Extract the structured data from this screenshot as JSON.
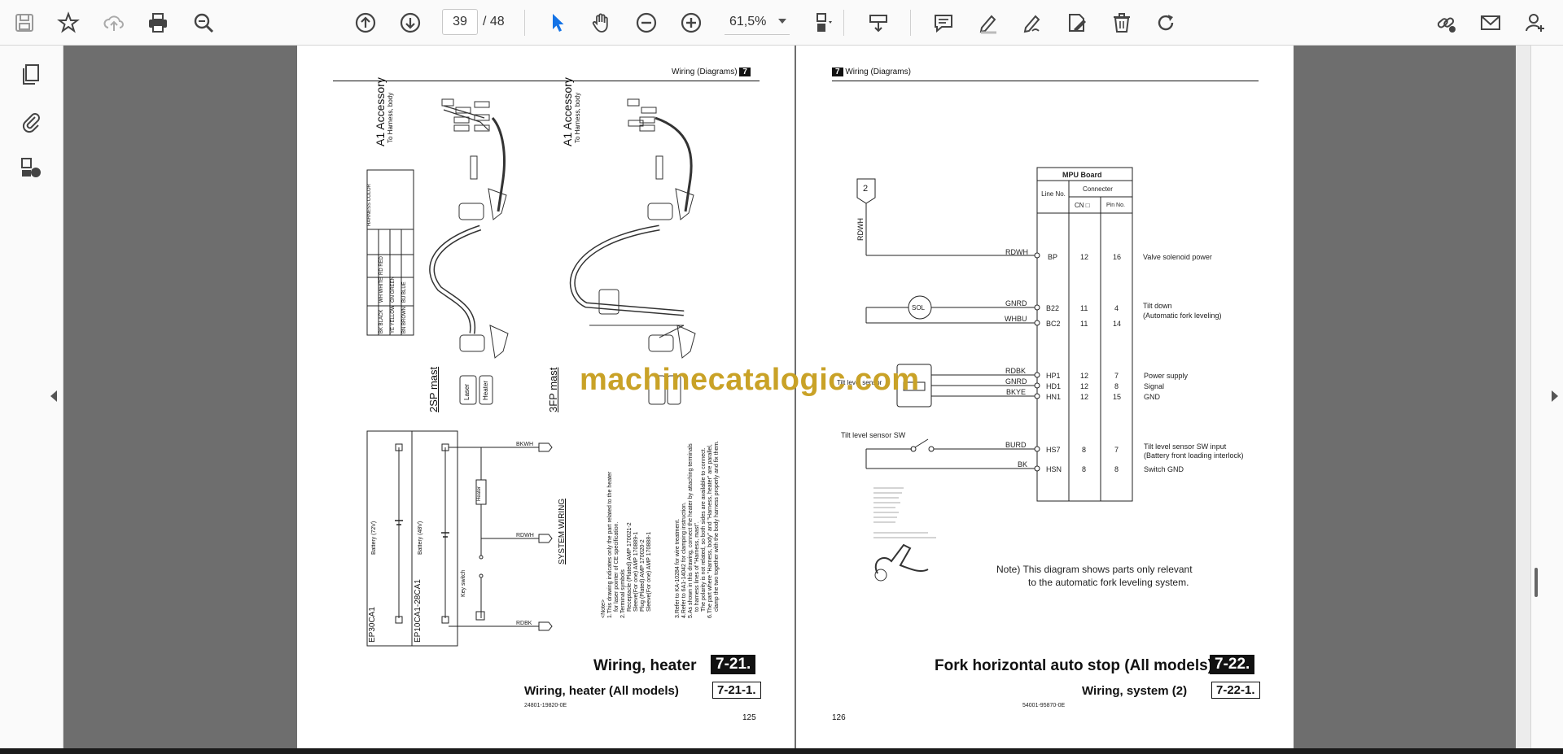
{
  "toolbar": {
    "current_page": "39",
    "total_pages": "/ 48",
    "zoom": "61,5%"
  },
  "page_left": {
    "header": "Wiring (Diagrams)",
    "chapter": "7",
    "accessory_label_1": "A1 Accessory",
    "accessory_label_2": "A1 Accessory",
    "to_harness_1": "To Harness, body",
    "to_harness_2": "To Harness, body",
    "mast_1": "2SP mast",
    "mast_2": "3FP mast",
    "harness_color_title": "HARNESS COLOR",
    "harness_colors": [
      "BK BLACK",
      "YE YELLOW",
      "BN BROWN",
      "WH WHITE",
      "GN GREEN",
      "BU BLUE",
      "RD RED"
    ],
    "laser": "Laser",
    "heater": "Heater",
    "battery_72": "Battery (72V)",
    "battery_48": "Battery (48V)",
    "model_1": "EP30CA1",
    "model_2": "EP10CA1-28CA1",
    "key_switch": "Key switch",
    "heater_box": "Heater",
    "system_wiring": "SYSTEM WIRING",
    "wire_bkwh": "BKWH",
    "wire_rdwh": "RDWH",
    "wire_rdbk": "RDBK",
    "notes": [
      "<Note>",
      "1.This drawing indicates only the part related to the heater",
      "for laser pointer of CE specification.",
      "2.Terminal symbols",
      "Receptacle (Plated)  AMP 170021-2",
      "Sleeve(For one)  AMP 170889-1",
      "Plug (Plated)  AMP 170020-2",
      "Sleeve(For one)  AMP 170888-1",
      "3.Refer to KA-10284 for wire treatment.",
      "4.Refer to 6A1-14042 for clamping instruction.",
      "5.As shown in this drawing, connect the heater by attaching terminals",
      "to harness lines of \"Harness, mast\".",
      "The polarity is not related, so both sides are available to connect.",
      "6.The part where \"Harness, body\" and \"Harness, heater\" are parallel,",
      "clamp the two together with the body harness properly and fix them."
    ],
    "title": "Wiring, heater",
    "number": "7-21.",
    "subtitle": "Wiring, heater (All models)",
    "subnumber": "7-21-1.",
    "docno": "24801-19820-0E",
    "page_no": "125"
  },
  "page_right": {
    "header": "Wiring (Diagrams)",
    "chapter": "7",
    "mpu_board": "MPU Board",
    "line_no": "Line No.",
    "connector": "Connecter",
    "cn": "CN □",
    "pin_no": "Pin No.",
    "ref_2": "2",
    "wire_rdwh": "RDWH",
    "rows": [
      {
        "wire": "RDWH",
        "line": "BP",
        "cn": "12",
        "pin": "16",
        "desc": "Valve solenoid power"
      },
      {
        "wire": "GNRD",
        "line": "B22",
        "cn": "11",
        "pin": "4",
        "desc": "Tilt down"
      },
      {
        "wire": "WHBU",
        "line": "BC2",
        "cn": "11",
        "pin": "14",
        "desc": "(Automatic fork leveling)"
      },
      {
        "wire": "RDBK",
        "line": "HP1",
        "cn": "12",
        "pin": "7",
        "desc": "Power supply"
      },
      {
        "wire": "GNRD",
        "line": "HD1",
        "cn": "12",
        "pin": "8",
        "desc": "Signal"
      },
      {
        "wire": "BKYE",
        "line": "HN1",
        "cn": "12",
        "pin": "15",
        "desc": "GND"
      },
      {
        "wire": "BURD",
        "line": "HS7",
        "cn": "8",
        "pin": "7",
        "desc": "Tilt level sensor SW input"
      },
      {
        "wire": "BK",
        "line": "HSN",
        "cn": "8",
        "pin": "8",
        "desc": "Switch GND"
      }
    ],
    "battery_interlock": "(Battery front loading interlock)",
    "sol": "SOL",
    "tilt_level_sensor": "Tilt level sensor",
    "tilt_level_sensor_sw": "Tilt level sensor SW",
    "note_1": "Note) This diagram shows parts only relevant",
    "note_2": "to the automatic fork leveling system.",
    "title": "Fork horizontal auto stop (All models)",
    "number": "7-22.",
    "subtitle": "Wiring, system (2)",
    "subnumber": "7-22-1.",
    "docno": "54001-95870-0E",
    "page_no": "126"
  },
  "watermark": "machinecatalogic.com",
  "colors": {
    "accent": "#1473e6",
    "watermark": "#c9a227"
  }
}
